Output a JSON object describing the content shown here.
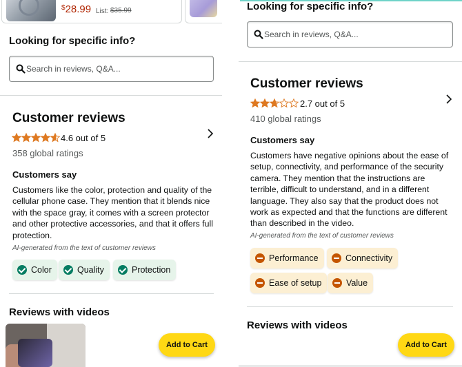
{
  "colors": {
    "price": "#b12704",
    "link": "#0f1111",
    "positive_chip_bg": "#e6f4ea",
    "positive_icon": "#067d62",
    "negative_chip_bg": "#fcefd3",
    "negative_icon": "#c45500",
    "star": "#de7921",
    "cart_button": "#ffd814"
  },
  "left": {
    "product_card": {
      "price_symbol": "$",
      "price": "28.99",
      "list_label": "List:",
      "list_price": "$35.99"
    },
    "search": {
      "heading": "Looking for specific info?",
      "placeholder": "Search in reviews, Q&A..."
    },
    "reviews": {
      "title": "Customer reviews",
      "rating_value": 4.6,
      "rating_text": "4.6 out of 5",
      "global_ratings": "358 global ratings",
      "customers_say": "Customers say",
      "summary": "Customers like the color, protection and quality of the cellular phone case. They mention that it blends nice with the space gray, it comes with a screen protector and other protective accessories, and that it offers full protection.",
      "ai_note": "AI-generated from the text of customer reviews",
      "chips": [
        {
          "label": "Color",
          "sentiment": "positive"
        },
        {
          "label": "Quality",
          "sentiment": "positive"
        },
        {
          "label": "Protection",
          "sentiment": "positive"
        }
      ]
    },
    "reviews_with_videos": "Reviews with videos",
    "add_to_cart": "Add to Cart"
  },
  "right": {
    "search": {
      "heading": "Looking for specific info?",
      "placeholder": "Search in reviews, Q&A..."
    },
    "reviews": {
      "title": "Customer reviews",
      "rating_value": 2.7,
      "rating_text": "2.7 out of 5",
      "global_ratings": "410 global ratings",
      "customers_say": "Customers say",
      "summary": "Customers have negative opinions about the ease of setup, connectivity, and performance of the security camera. They mention that the instructions are terrible, difficult to understand, and in a different language. They also say that the product does not work as expected and that the functions are different than described in the video.",
      "ai_note": "AI-generated from the text of customer reviews",
      "chips": [
        {
          "label": "Performance",
          "sentiment": "negative"
        },
        {
          "label": "Connectivity",
          "sentiment": "negative"
        },
        {
          "label": "Ease of setup",
          "sentiment": "negative"
        },
        {
          "label": "Value",
          "sentiment": "negative"
        }
      ]
    },
    "reviews_with_videos": "Reviews with videos",
    "add_to_cart": "Add to Cart"
  },
  "icons": {
    "search": "search-icon",
    "chevron": "chevron-right-icon",
    "star": "star-icon",
    "positive": "check-circle-icon",
    "negative": "minus-circle-icon"
  }
}
